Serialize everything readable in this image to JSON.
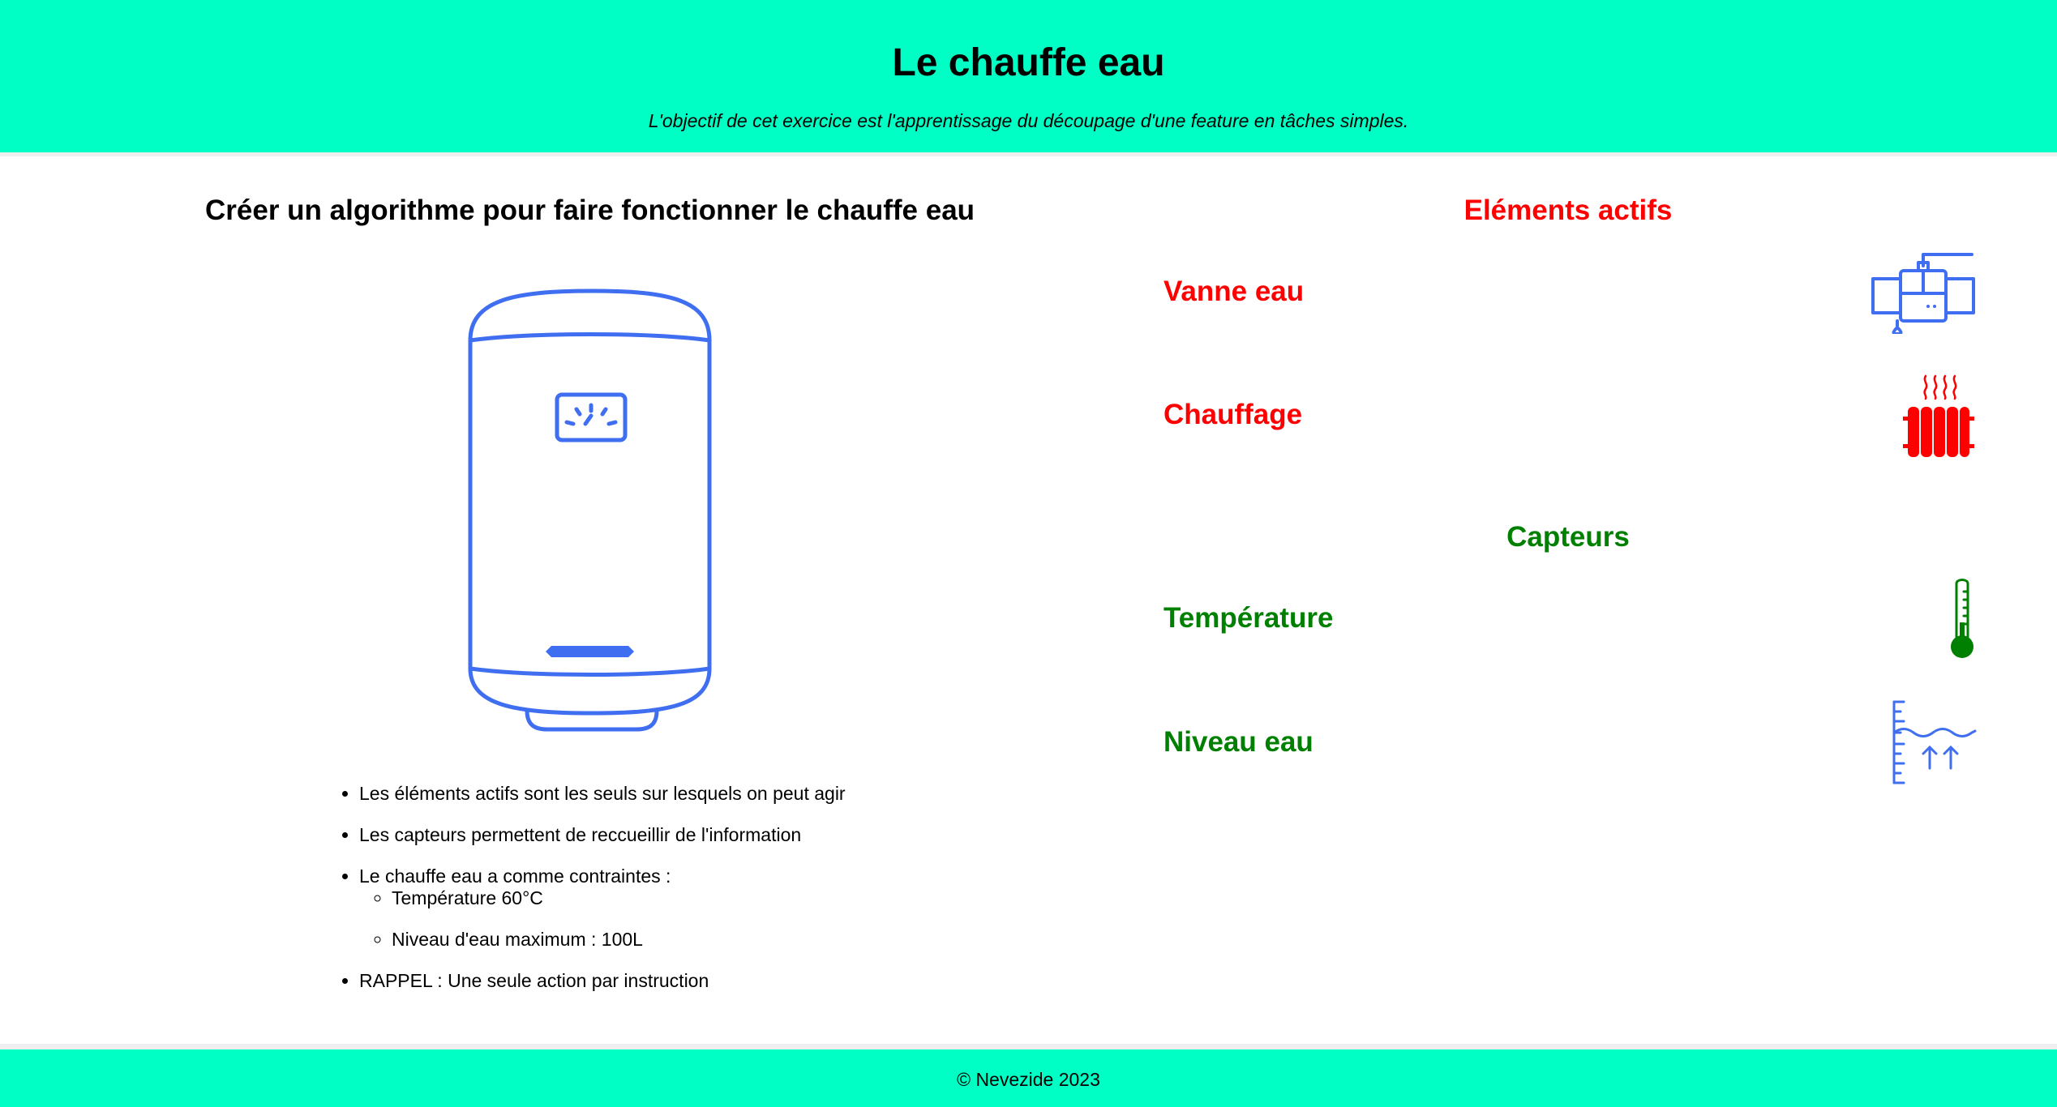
{
  "header": {
    "title": "Le chauffe eau",
    "subtitle": "L'objectif de cet exercice est l'apprentissage du découpage d'une feature en tâches simples."
  },
  "main": {
    "title": "Créer un algorithme pour faire fonctionner le chauffe eau",
    "notes": [
      "Les éléments actifs sont les seuls sur lesquels on peut agir",
      "Les capteurs permettent de reccueillir de l'information",
      "Le chauffe eau a comme contraintes :",
      "RAPPEL : Une seule action par instruction"
    ],
    "constraints": [
      "Température 60°C",
      "Niveau d'eau maximum : 100L"
    ]
  },
  "actifs": {
    "title": "Eléments actifs",
    "items": [
      {
        "label": "Vanne eau",
        "icon": "water-valve-icon"
      },
      {
        "label": "Chauffage",
        "icon": "radiator-icon"
      }
    ]
  },
  "capteurs": {
    "title": "Capteurs",
    "items": [
      {
        "label": "Température",
        "icon": "thermometer-icon"
      },
      {
        "label": "Niveau eau",
        "icon": "water-level-icon"
      }
    ]
  },
  "footer": {
    "text": "© Nevezide 2023"
  },
  "colors": {
    "banner": "#00ffc4",
    "actifs": "#ff0000",
    "capteurs": "#008000",
    "illustration": "#3f6ef0"
  }
}
